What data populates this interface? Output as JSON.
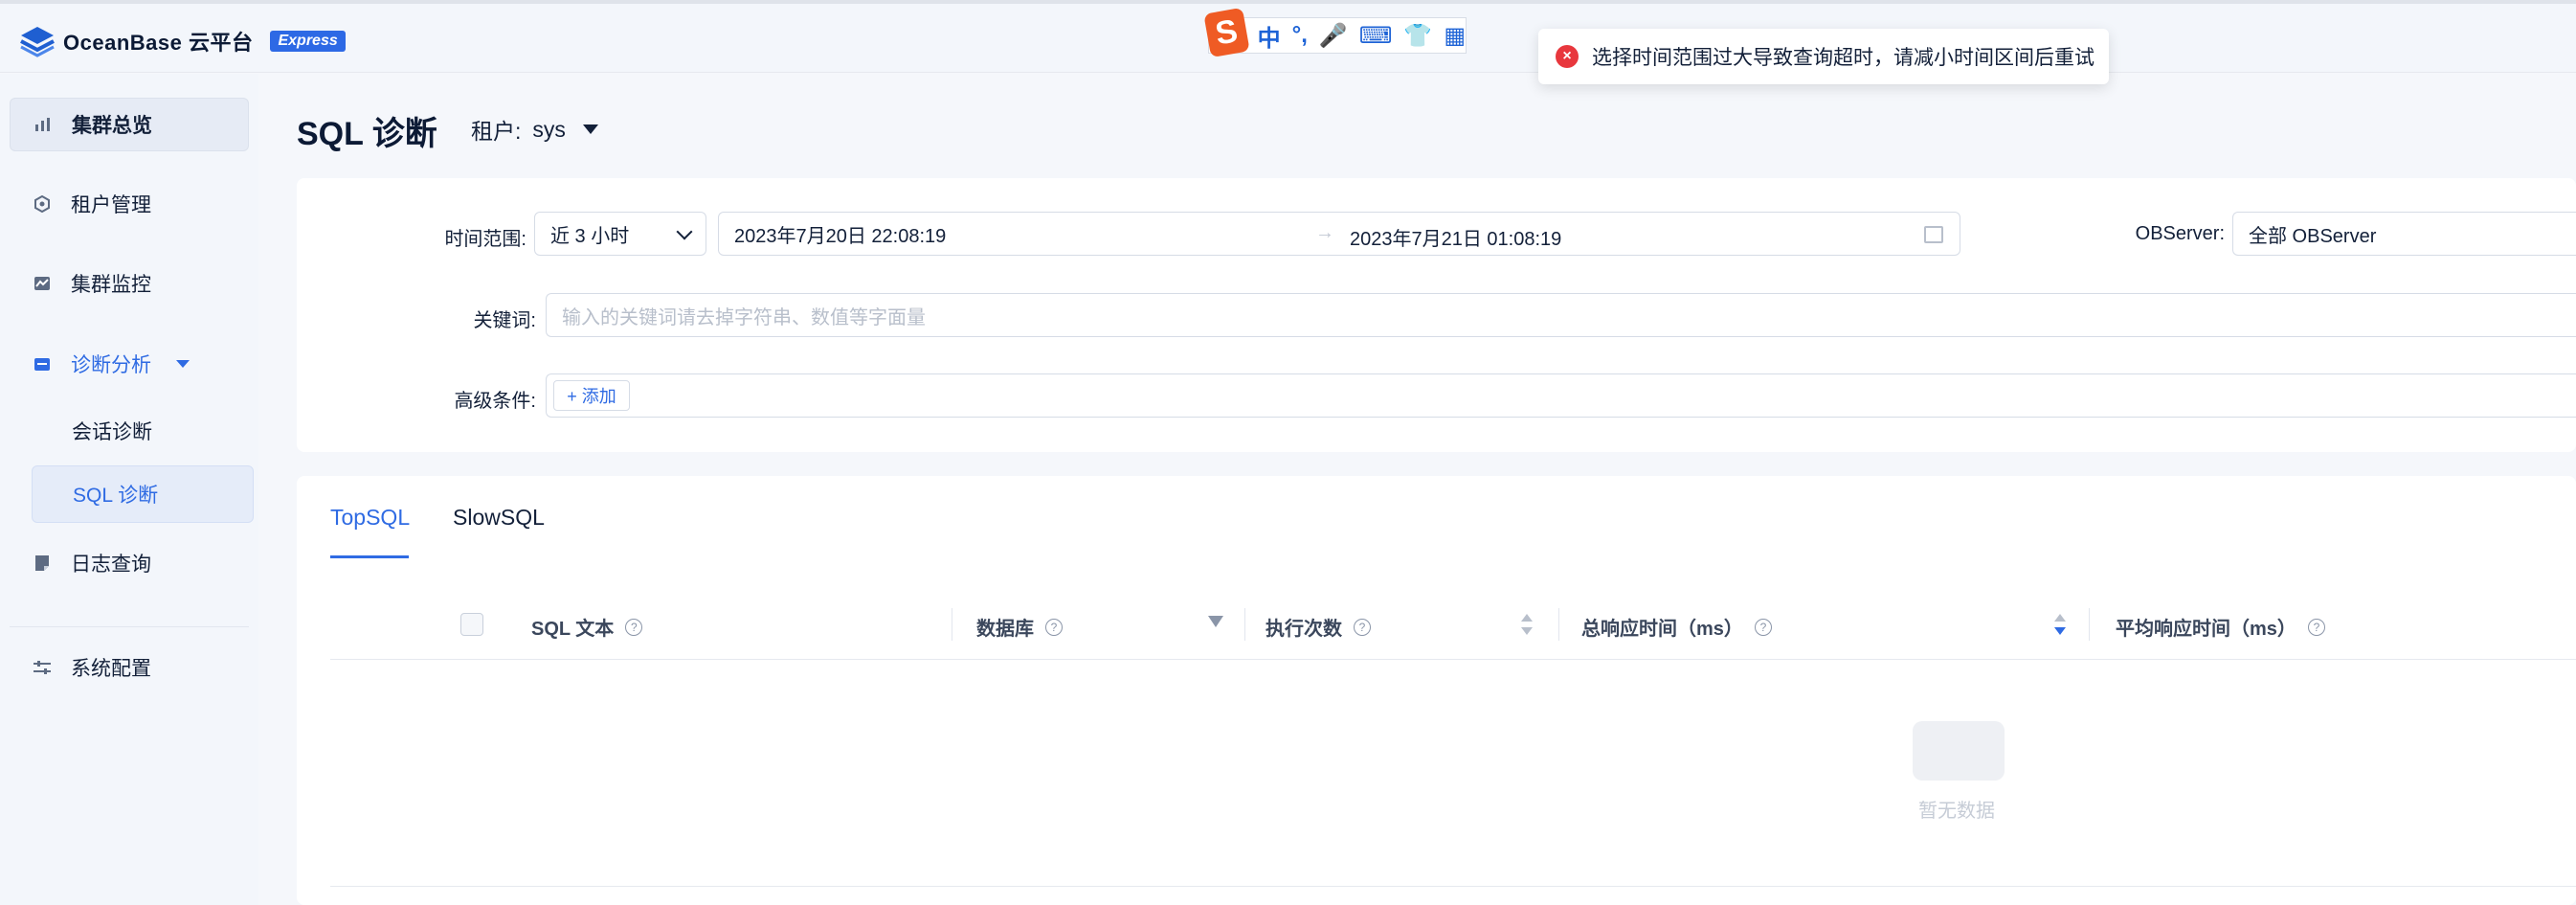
{
  "header": {
    "logo_text": "OceanBase 云平台",
    "badge": "Express"
  },
  "ime": {
    "icon": "sogou-s-icon",
    "items": [
      "中",
      "°,",
      "🎤",
      "⌨",
      "👕",
      "▦"
    ]
  },
  "toast": {
    "icon": "error-icon",
    "message": "选择时间范围过大导致查询超时，请减小时间区间后重试"
  },
  "sidebar": {
    "items": [
      {
        "label": "集群总览",
        "icon": "bar-chart-icon"
      },
      {
        "label": "租户管理",
        "icon": "hexagon-icon"
      },
      {
        "label": "集群监控",
        "icon": "line-chart-icon"
      },
      {
        "label": "诊断分析",
        "icon": "calendar-icon"
      },
      {
        "label": "会话诊断"
      },
      {
        "label": "SQL 诊断"
      },
      {
        "label": "日志查询",
        "icon": "document-icon"
      },
      {
        "label": "系统配置",
        "icon": "sliders-icon"
      }
    ]
  },
  "page": {
    "title": "SQL 诊断",
    "tenant_label": "租户:",
    "tenant_value": "sys"
  },
  "filters": {
    "time_range_label": "时间范围:",
    "time_range_value": "近 3 小时",
    "start": "2023年7月20日 22:08:19",
    "arrow": "→",
    "end": "2023年7月21日 01:08:19",
    "observer_label": "OBServer:",
    "observer_value": "全部 OBServer",
    "keyword_label": "关键词:",
    "keyword_placeholder": "输入的关键词请去掉字符串、数值等字面量",
    "advanced_label": "高级条件:",
    "add_label": "+ 添加"
  },
  "tabs": [
    "TopSQL",
    "SlowSQL"
  ],
  "table": {
    "columns": [
      "SQL 文本",
      "数据库",
      "执行次数",
      "总响应时间（ms）",
      "平均响应时间（ms）"
    ],
    "help_glyph": "?",
    "empty_text": "暂无数据"
  }
}
